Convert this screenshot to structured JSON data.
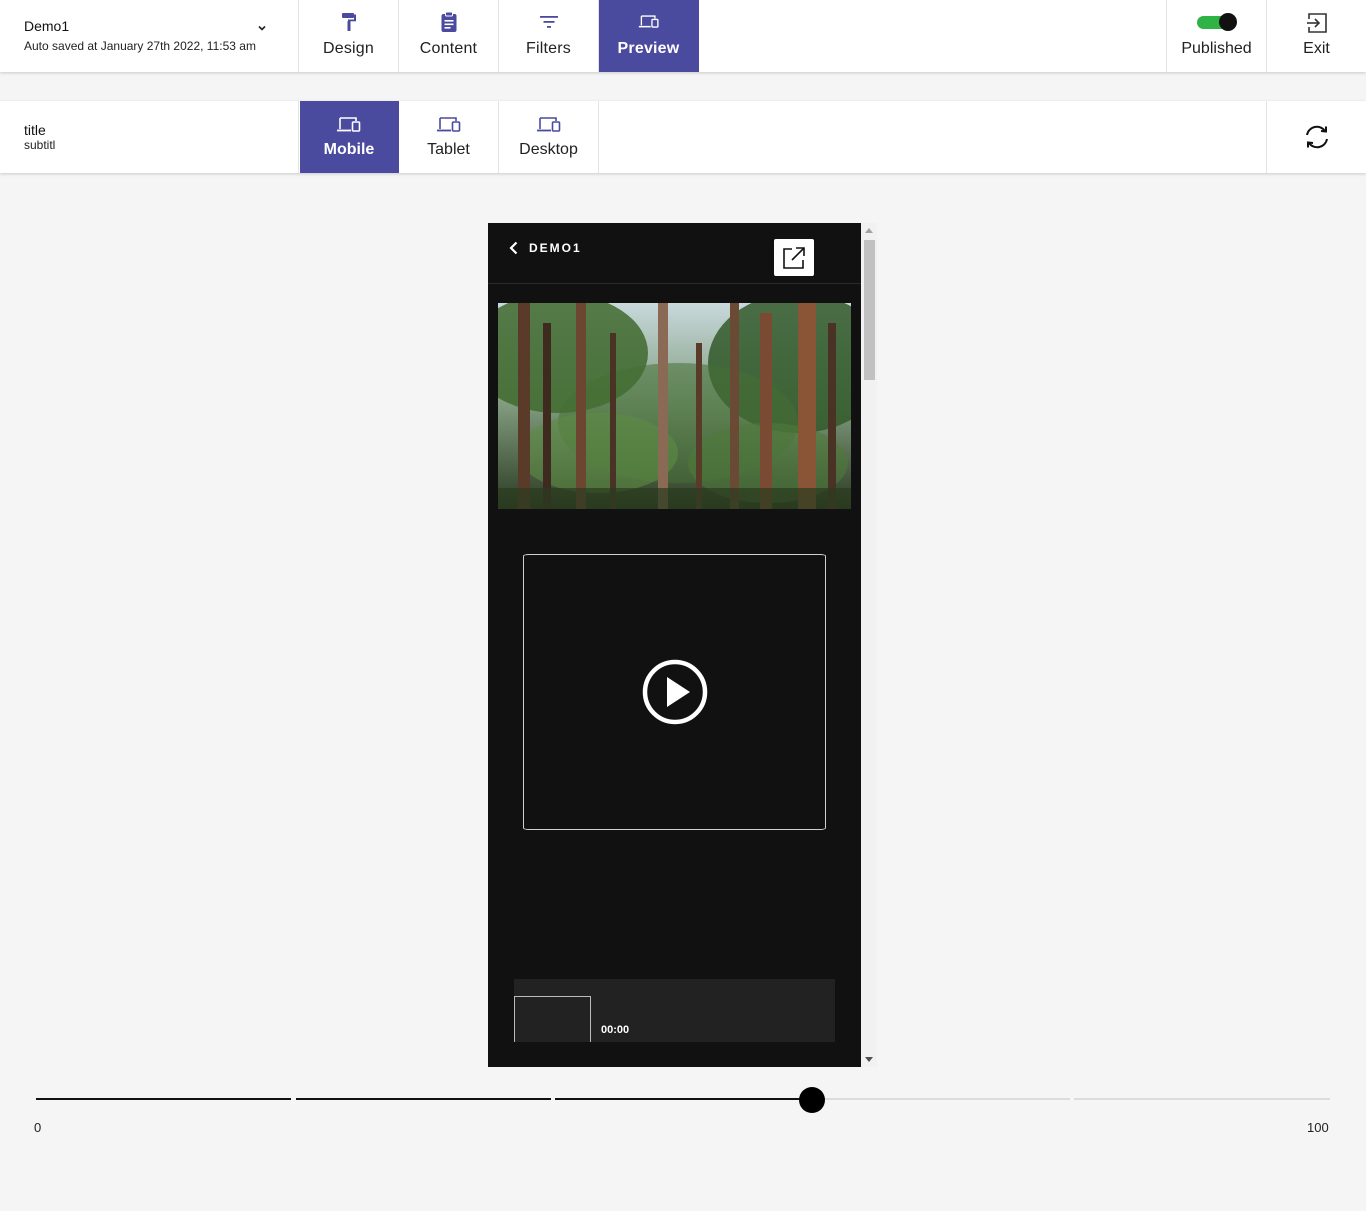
{
  "topbar": {
    "project_name": "Demo1",
    "saved_text": "Auto saved at January 27th 2022, 11:53 am",
    "nav": [
      {
        "label": "Design",
        "icon": "paint-roller-icon"
      },
      {
        "label": "Content",
        "icon": "clipboard-icon"
      },
      {
        "label": "Filters",
        "icon": "filter-icon"
      },
      {
        "label": "Preview",
        "icon": "devices-icon",
        "active": true
      }
    ],
    "published_label": "Published",
    "published_on": true,
    "exit_label": "Exit"
  },
  "subbar": {
    "title": "title",
    "subtitle": "subtitl",
    "devices": [
      {
        "label": "Mobile",
        "active": true
      },
      {
        "label": "Tablet"
      },
      {
        "label": "Desktop"
      }
    ]
  },
  "preview": {
    "header_title": "DEMO1",
    "player_time": "00:00"
  },
  "slider": {
    "min_label": "0",
    "max_label": "100",
    "value": 60
  },
  "colors": {
    "accent": "#4a4a9e",
    "toggle_on": "#2fb344",
    "preview_bg": "#111111"
  }
}
